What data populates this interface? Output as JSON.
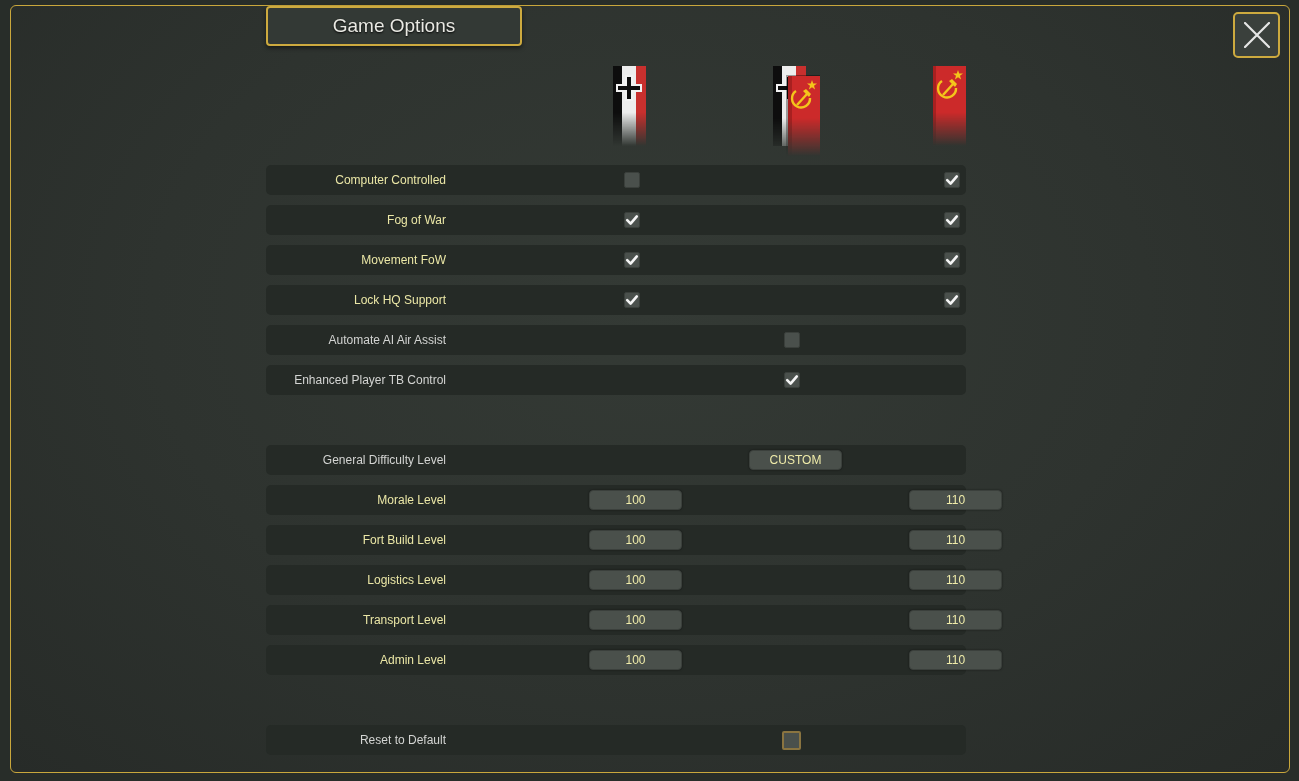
{
  "window": {
    "title": "Game Options"
  },
  "sections": [
    {
      "rows": [
        {
          "label": "Computer Controlled",
          "kind": "per_side",
          "controls": [
            {
              "kind": "checkbox",
              "checked": false
            },
            {
              "kind": "checkbox",
              "checked": true
            }
          ]
        },
        {
          "label": "Fog of War",
          "kind": "per_side",
          "controls": [
            {
              "kind": "checkbox",
              "checked": true
            },
            {
              "kind": "checkbox",
              "checked": true
            }
          ]
        },
        {
          "label": "Movement FoW",
          "kind": "per_side",
          "controls": [
            {
              "kind": "checkbox",
              "checked": true
            },
            {
              "kind": "checkbox",
              "checked": true
            }
          ]
        },
        {
          "label": "Lock HQ Support",
          "kind": "per_side",
          "controls": [
            {
              "kind": "checkbox",
              "checked": true
            },
            {
              "kind": "checkbox",
              "checked": true
            }
          ]
        },
        {
          "label": "Automate AI Air Assist",
          "kind": "shared",
          "controls": [
            {
              "kind": "checkbox",
              "checked": false
            }
          ]
        },
        {
          "label": "Enhanced Player TB Control",
          "kind": "shared",
          "controls": [
            {
              "kind": "checkbox",
              "checked": true
            }
          ]
        }
      ]
    },
    {
      "rows": [
        {
          "label": "General Difficulty Level",
          "kind": "shared",
          "controls": [
            {
              "kind": "value",
              "text": "CUSTOM"
            }
          ]
        },
        {
          "label": "Morale Level",
          "kind": "per_side",
          "controls": [
            {
              "kind": "value",
              "text": "100"
            },
            {
              "kind": "value",
              "text": "110"
            }
          ]
        },
        {
          "label": "Fort Build Level",
          "kind": "per_side",
          "controls": [
            {
              "kind": "value",
              "text": "100"
            },
            {
              "kind": "value",
              "text": "110"
            }
          ]
        },
        {
          "label": "Logistics Level",
          "kind": "per_side",
          "controls": [
            {
              "kind": "value",
              "text": "100"
            },
            {
              "kind": "value",
              "text": "110"
            }
          ]
        },
        {
          "label": "Transport Level",
          "kind": "per_side",
          "controls": [
            {
              "kind": "value",
              "text": "100"
            },
            {
              "kind": "value",
              "text": "110"
            }
          ]
        },
        {
          "label": "Admin Level",
          "kind": "per_side",
          "controls": [
            {
              "kind": "value",
              "text": "100"
            },
            {
              "kind": "value",
              "text": "110"
            }
          ]
        }
      ]
    },
    {
      "rows": [
        {
          "label": "Reset to Default",
          "kind": "shared",
          "controls": [
            {
              "kind": "button"
            }
          ]
        }
      ]
    }
  ]
}
